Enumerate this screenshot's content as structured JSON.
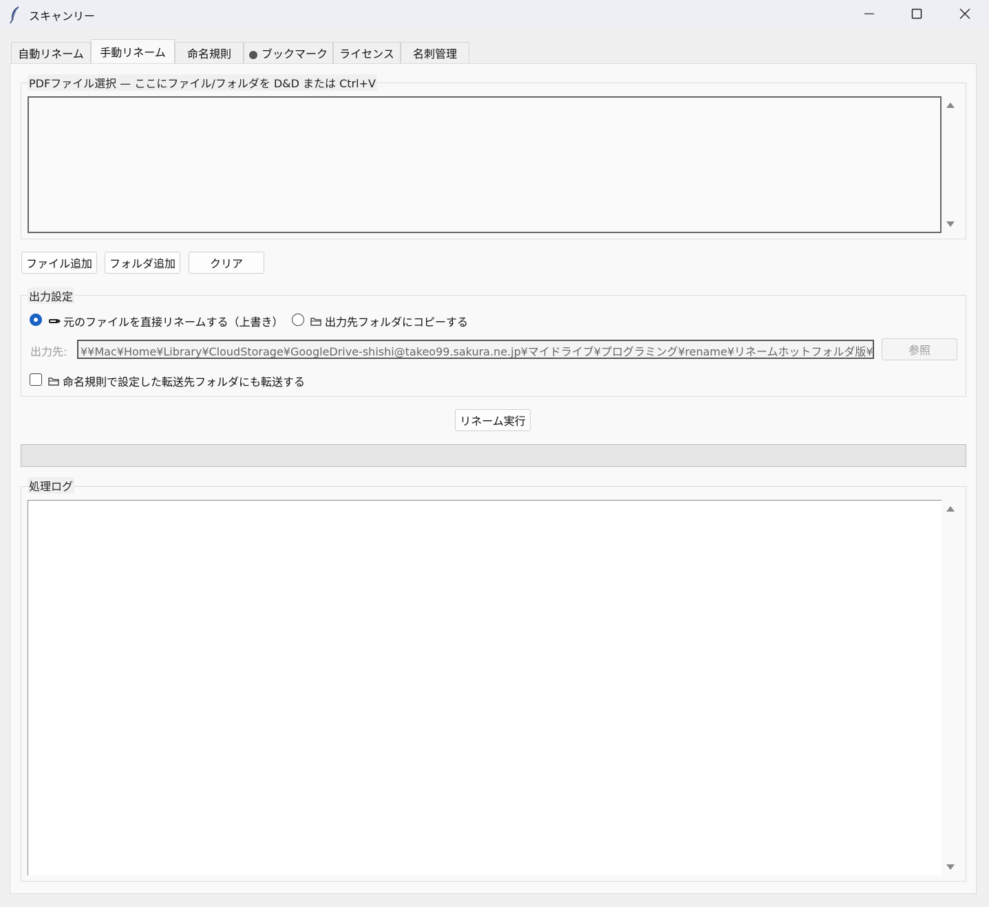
{
  "window": {
    "title": "スキャンリー",
    "icon": "feather-icon",
    "controls": [
      "minimize-icon",
      "maximize-icon",
      "close-icon"
    ]
  },
  "tabs": [
    {
      "label": "自動リネーム",
      "active": false
    },
    {
      "label": "手動リネーム",
      "active": true
    },
    {
      "label": "命名規則",
      "active": false
    },
    {
      "label": "ブックマーク",
      "active": false,
      "icon": "circle-icon"
    },
    {
      "label": "ライセンス",
      "active": false
    },
    {
      "label": "名刺管理",
      "active": false
    }
  ],
  "file_select": {
    "group_label": "PDFファイル選択 — ここにファイル/フォルダを D&D または Ctrl+V",
    "buttons": {
      "add_file": "ファイル追加",
      "add_folder": "フォルダ追加",
      "clear": "クリア"
    }
  },
  "output_settings": {
    "group_label": "出力設定",
    "radio_overwrite": {
      "label": "元のファイルを直接リネームする（上書き）",
      "icon": "pencil-icon",
      "selected": true
    },
    "radio_copy": {
      "label": "出力先フォルダにコピーする",
      "icon": "folder-icon",
      "selected": false
    },
    "dest_label": "出力先:",
    "dest_value": "¥¥Mac¥Home¥Library¥CloudStorage¥GoogleDrive-shishi@takeo99.sakura.ne.jp¥マイドライブ¥プログラミング¥rename¥リネームホットフォルダ版¥output",
    "browse_label": "参照",
    "transfer_checkbox": {
      "label": "命名規則で設定した転送先フォルダにも転送する",
      "icon": "folder-icon",
      "checked": false
    }
  },
  "run_button": "リネーム実行",
  "progress": 0,
  "log": {
    "group_label": "処理ログ"
  }
}
